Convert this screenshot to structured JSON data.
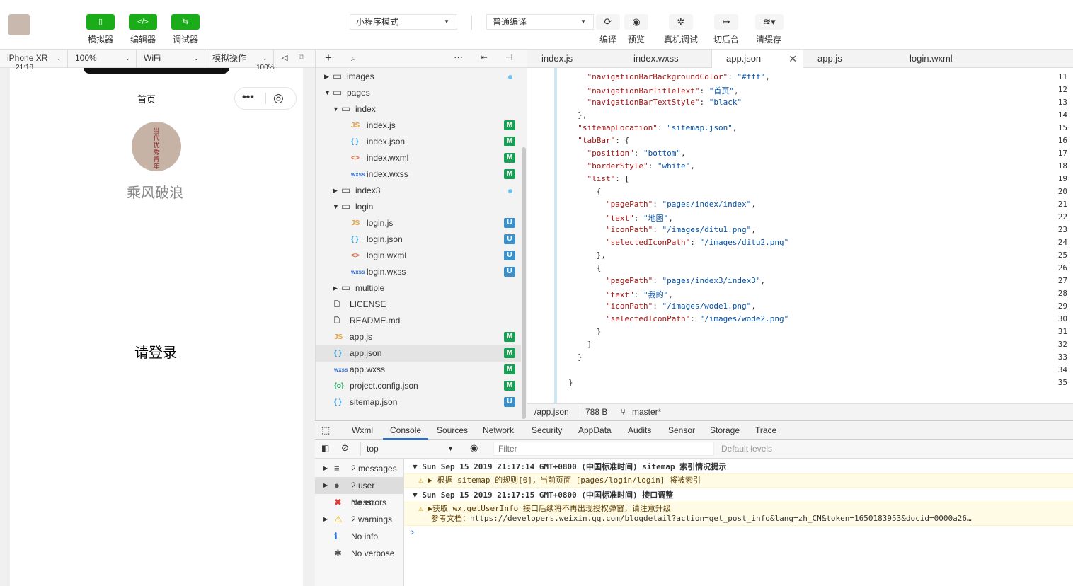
{
  "toolbar": {
    "buttons": [
      {
        "label": "模拟器",
        "icon": "phone-icon"
      },
      {
        "label": "编辑器",
        "icon": "code-icon"
      },
      {
        "label": "调试器",
        "icon": "debug-icon"
      }
    ],
    "mode_select": "小程序模式",
    "compile_select": "普通编译",
    "actions": [
      {
        "label": "编译",
        "icon": "refresh-icon"
      },
      {
        "label": "预览",
        "icon": "eye-icon"
      },
      {
        "label": "真机调试",
        "icon": "bug-icon"
      },
      {
        "label": "切后台",
        "icon": "switch-background-icon"
      },
      {
        "label": "清缓存",
        "icon": "layers-icon"
      }
    ]
  },
  "simulator": {
    "device": "iPhone XR",
    "zoom": "100%",
    "network": "WiFi",
    "operate": "模拟操作",
    "status_time": "21:18",
    "status_battery": "100%",
    "nav_title": "首页",
    "profile_avatar_text": "当代优秀青年",
    "username": "乘风破浪",
    "login_text": "请登录"
  },
  "file_tree": [
    {
      "name": "images",
      "type": "folder",
      "depth": 0,
      "expanded": false,
      "dot": true
    },
    {
      "name": "pages",
      "type": "folder",
      "depth": 0,
      "expanded": true
    },
    {
      "name": "index",
      "type": "folder",
      "depth": 1,
      "expanded": true
    },
    {
      "name": "index.js",
      "type": "js",
      "depth": 2,
      "badge": "M"
    },
    {
      "name": "index.json",
      "type": "json",
      "depth": 2,
      "badge": "M"
    },
    {
      "name": "index.wxml",
      "type": "wxml",
      "depth": 2,
      "badge": "M"
    },
    {
      "name": "index.wxss",
      "type": "wxss",
      "depth": 2,
      "badge": "M"
    },
    {
      "name": "index3",
      "type": "folder",
      "depth": 1,
      "expanded": false,
      "dot": true
    },
    {
      "name": "login",
      "type": "folder",
      "depth": 1,
      "expanded": true
    },
    {
      "name": "login.js",
      "type": "js",
      "depth": 2,
      "badge": "U"
    },
    {
      "name": "login.json",
      "type": "json",
      "depth": 2,
      "badge": "U"
    },
    {
      "name": "login.wxml",
      "type": "wxml",
      "depth": 2,
      "badge": "U"
    },
    {
      "name": "login.wxss",
      "type": "wxss",
      "depth": 2,
      "badge": "U"
    },
    {
      "name": "multiple",
      "type": "folder",
      "depth": 1,
      "expanded": false
    },
    {
      "name": "LICENSE",
      "type": "file",
      "depth": 0
    },
    {
      "name": "README.md",
      "type": "file",
      "depth": 0
    },
    {
      "name": "app.js",
      "type": "js",
      "depth": 0,
      "badge": "M"
    },
    {
      "name": "app.json",
      "type": "json",
      "depth": 0,
      "badge": "M",
      "selected": true
    },
    {
      "name": "app.wxss",
      "type": "wxss",
      "depth": 0,
      "badge": "M"
    },
    {
      "name": "project.config.json",
      "type": "config",
      "depth": 0,
      "badge": "M"
    },
    {
      "name": "sitemap.json",
      "type": "json",
      "depth": 0,
      "badge": "U"
    }
  ],
  "editor_tabs": [
    {
      "label": "index.js",
      "active": false
    },
    {
      "label": "index.wxss",
      "active": false
    },
    {
      "label": "app.json",
      "active": true
    },
    {
      "label": "app.js",
      "active": false
    },
    {
      "label": "login.wxml",
      "active": false
    }
  ],
  "code_lines": [
    {
      "n": "11",
      "text": "    \"navigationBarBackgroundColor\": \"#fff\","
    },
    {
      "n": "12",
      "text": "    \"navigationBarTitleText\": \"首页\","
    },
    {
      "n": "13",
      "text": "    \"navigationBarTextStyle\": \"black\""
    },
    {
      "n": "14",
      "text": "  },"
    },
    {
      "n": "15",
      "text": "  \"sitemapLocation\": \"sitemap.json\","
    },
    {
      "n": "16",
      "text": "  \"tabBar\": {"
    },
    {
      "n": "17",
      "text": "    \"position\": \"bottom\","
    },
    {
      "n": "18",
      "text": "    \"borderStyle\": \"white\","
    },
    {
      "n": "19",
      "text": "    \"list\": ["
    },
    {
      "n": "20",
      "text": "      {"
    },
    {
      "n": "21",
      "text": "        \"pagePath\": \"pages/index/index\","
    },
    {
      "n": "22",
      "text": "        \"text\": \"地图\","
    },
    {
      "n": "23",
      "text": "        \"iconPath\": \"/images/ditu1.png\","
    },
    {
      "n": "24",
      "text": "        \"selectedIconPath\": \"/images/ditu2.png\""
    },
    {
      "n": "25",
      "text": "      },"
    },
    {
      "n": "26",
      "text": "      {"
    },
    {
      "n": "27",
      "text": "        \"pagePath\": \"pages/index3/index3\","
    },
    {
      "n": "28",
      "text": "        \"text\": \"我的\","
    },
    {
      "n": "29",
      "text": "        \"iconPath\": \"/images/wode1.png\","
    },
    {
      "n": "30",
      "text": "        \"selectedIconPath\": \"/images/wode2.png\""
    },
    {
      "n": "31",
      "text": "      }"
    },
    {
      "n": "32",
      "text": "    ]"
    },
    {
      "n": "33",
      "text": "  }"
    },
    {
      "n": "34",
      "text": ""
    },
    {
      "n": "35",
      "text": "}"
    }
  ],
  "status_bar": {
    "path": "/app.json",
    "size": "788 B",
    "branch": "master*"
  },
  "devtools": {
    "tabs": [
      "Wxml",
      "Console",
      "Sources",
      "Network",
      "Security",
      "AppData",
      "Audits",
      "Sensor",
      "Storage",
      "Trace"
    ],
    "active_tab": "Console",
    "context": "top",
    "filter_placeholder": "Filter",
    "levels": "Default levels",
    "sidebar": [
      {
        "label": "2 messages",
        "icon": "list-icon"
      },
      {
        "label": "2 user mess...",
        "icon": "user-icon",
        "selected": true
      },
      {
        "label": "No errors",
        "icon": "error-icon"
      },
      {
        "label": "2 warnings",
        "icon": "warning-icon"
      },
      {
        "label": "No info",
        "icon": "info-icon"
      },
      {
        "label": "No verbose",
        "icon": "verbose-icon"
      }
    ],
    "messages": {
      "group1": "Sun Sep 15 2019 21:17:14 GMT+0800 (中国标准时间) sitemap 索引情况提示",
      "warn1": "根据 sitemap 的规则[0]，当前页面 [pages/login/login] 将被索引",
      "group2": "Sun Sep 15 2019 21:17:15 GMT+0800 (中国标准时间) 接口调整",
      "warn2": "获取 wx.getUserInfo 接口后续将不再出现授权弹窗，请注意升级",
      "doc_prefix": "参考文档：",
      "doc_link": "https://developers.weixin.qq.com/blogdetail?action=get_post_info&lang=zh_CN&token=1650183953&docid=0000a26…"
    }
  },
  "colors": {
    "accent_green": "#1aad19",
    "badge_modified": "#1b9e55",
    "badge_untracked": "#3c8fc7",
    "devtools_active": "#1a73e8"
  }
}
